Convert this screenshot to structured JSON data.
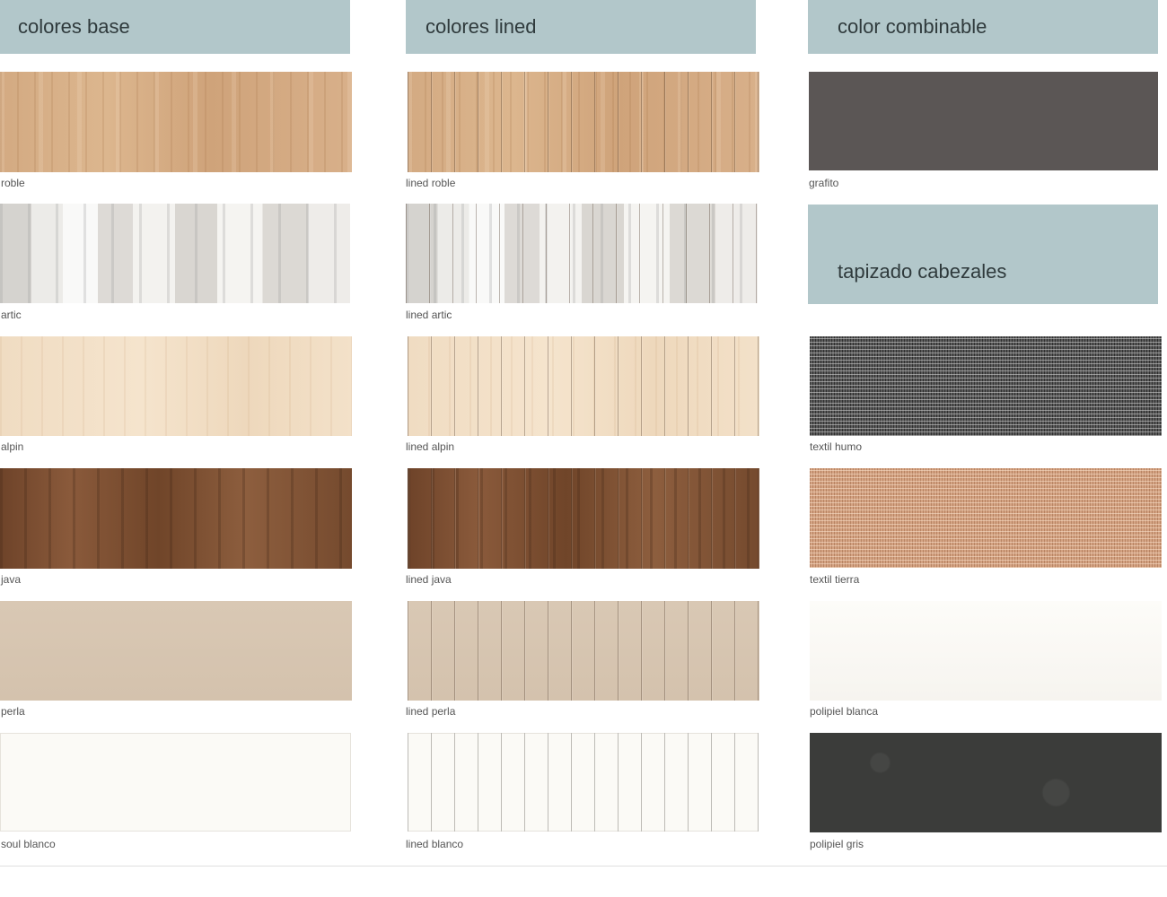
{
  "headers": {
    "base": "colores base",
    "lined": "colores lined",
    "combinable": "color combinable",
    "tapizado": "tapizado cabezales"
  },
  "base": [
    {
      "label": "roble"
    },
    {
      "label": "artic"
    },
    {
      "label": "alpin"
    },
    {
      "label": "java"
    },
    {
      "label": "perla"
    },
    {
      "label": "soul blanco"
    }
  ],
  "lined": [
    {
      "label": "lined roble"
    },
    {
      "label": "lined artic"
    },
    {
      "label": "lined alpin"
    },
    {
      "label": "lined java"
    },
    {
      "label": "lined perla"
    },
    {
      "label": "lined blanco"
    }
  ],
  "combinable": [
    {
      "label": "grafito"
    }
  ],
  "tapizado": [
    {
      "label": "textil humo"
    },
    {
      "label": "textil tierra"
    },
    {
      "label": "polipiel blanca"
    },
    {
      "label": "polipiel gris"
    }
  ],
  "colors": {
    "header_bg": "#b2c7ca",
    "grafito": "#5b5655",
    "polipiel_gris": "#3b3c3a"
  }
}
